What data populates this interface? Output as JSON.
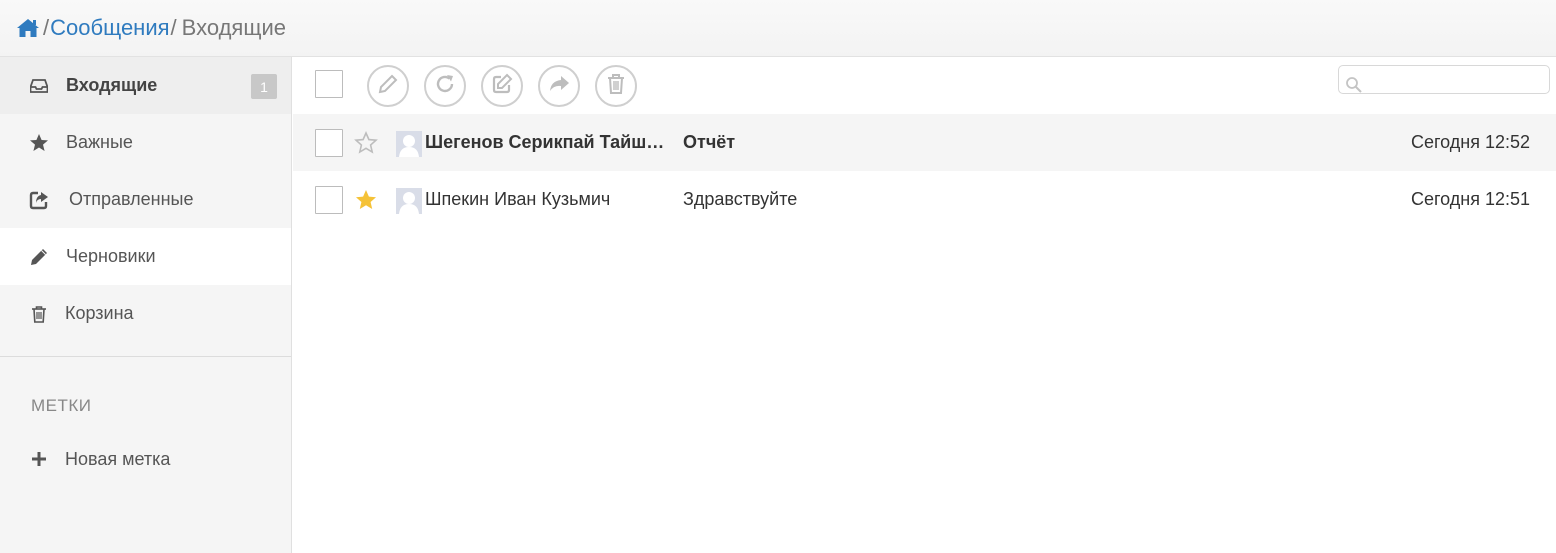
{
  "breadcrumb": {
    "home_icon": "home-icon",
    "items": [
      "Сообщения",
      "Входящие"
    ]
  },
  "sidebar": {
    "items": [
      {
        "icon": "inbox-icon",
        "label": "Входящие",
        "badge": "1",
        "active": true
      },
      {
        "icon": "star-icon",
        "label": "Важные"
      },
      {
        "icon": "share-icon",
        "label": "Отправленные"
      },
      {
        "icon": "pencil-icon",
        "label": "Черновики"
      },
      {
        "icon": "trash-icon",
        "label": "Корзина"
      }
    ],
    "labels_heading": "МЕТКИ",
    "new_label": {
      "icon": "plus-icon",
      "label": "Новая метка"
    }
  },
  "toolbar": {
    "buttons": [
      "compose-icon",
      "refresh-icon",
      "edit-icon",
      "forward-icon",
      "trash-icon"
    ],
    "search_placeholder": ""
  },
  "messages": [
    {
      "sender": "Шегенов Серикпай Тайшыкович",
      "subject": "Отчёт",
      "date": "Сегодня 12:52",
      "starred": false,
      "unread": true
    },
    {
      "sender": "Шпекин Иван Кузьмич",
      "subject": "Здравствуйте",
      "date": "Сегодня 12:51",
      "starred": true,
      "unread": false
    }
  ],
  "colors": {
    "link": "#2f7bbf",
    "star": "#f5c237",
    "badge": "#c8c8c8"
  }
}
